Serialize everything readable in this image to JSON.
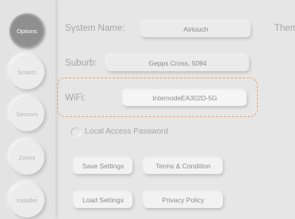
{
  "sidebar": {
    "items": [
      {
        "label": "Options",
        "active": true
      },
      {
        "label": "Smarts"
      },
      {
        "label": "Sensors"
      },
      {
        "label": "Zones"
      },
      {
        "label": "Installer"
      }
    ]
  },
  "form": {
    "system_name_label": "System Name:",
    "system_name_value": "Airtouch",
    "theme_label": "Them",
    "suburb_label": "Suburb:",
    "suburb_value": "Gepps Cross, 5094",
    "wifi_label": "WiFi:",
    "wifi_value": "InternodeEA302D-5G",
    "local_access_label": "Local Access Password"
  },
  "buttons": {
    "save_settings": "Save Settings",
    "terms": "Terms & Condition",
    "load_settings": "Load Settings",
    "privacy": "Privacy Policy"
  },
  "colors": {
    "highlight": "#f0a160",
    "active_nav": "#8f8f8f"
  }
}
